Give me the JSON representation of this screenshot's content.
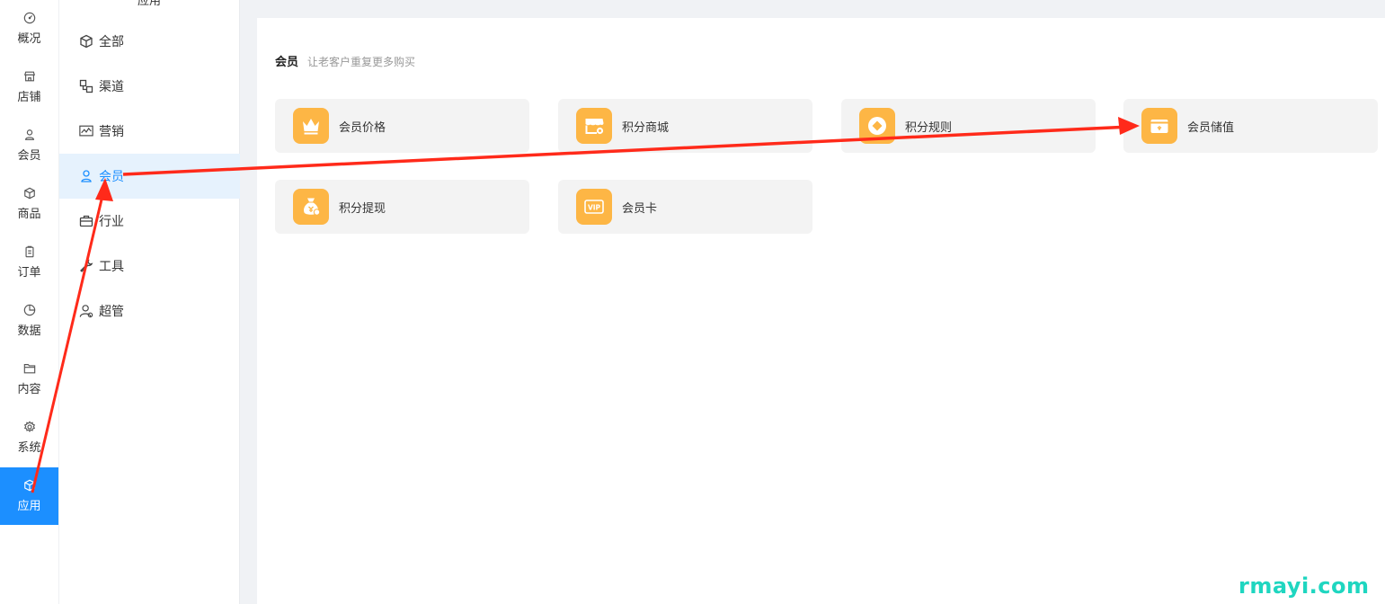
{
  "rail": {
    "items": [
      {
        "label": "概况",
        "icon": "dashboard-icon"
      },
      {
        "label": "店铺",
        "icon": "store-icon"
      },
      {
        "label": "会员",
        "icon": "user-icon"
      },
      {
        "label": "商品",
        "icon": "box-icon"
      },
      {
        "label": "订单",
        "icon": "clipboard-icon"
      },
      {
        "label": "数据",
        "icon": "pie-chart-icon"
      },
      {
        "label": "内容",
        "icon": "folder-icon"
      },
      {
        "label": "系统",
        "icon": "gear-icon"
      },
      {
        "label": "应用",
        "icon": "box-icon"
      }
    ],
    "active": "应用"
  },
  "submenu": {
    "title": "应用",
    "items": [
      {
        "label": "全部",
        "icon": "cube-icon"
      },
      {
        "label": "渠道",
        "icon": "channel-icon"
      },
      {
        "label": "营销",
        "icon": "trend-icon"
      },
      {
        "label": "会员",
        "icon": "user-icon"
      },
      {
        "label": "行业",
        "icon": "briefcase-icon"
      },
      {
        "label": "工具",
        "icon": "wrench-icon"
      },
      {
        "label": "超管",
        "icon": "admin-icon"
      }
    ],
    "active": "会员"
  },
  "main": {
    "section_title": "会员",
    "section_subtitle": "让老客户重复更多购买",
    "cards": [
      {
        "label": "会员价格",
        "icon": "crown-icon"
      },
      {
        "label": "积分商城",
        "icon": "shop-icon"
      },
      {
        "label": "积分规则",
        "icon": "coin-icon"
      },
      {
        "label": "会员储值",
        "icon": "wallet-icon"
      },
      {
        "label": "积分提现",
        "icon": "money-bag-icon"
      },
      {
        "label": "会员卡",
        "icon": "vip-card-icon"
      }
    ]
  },
  "watermark": "rmayi.com",
  "colors": {
    "accent": "#1c8fff",
    "active_bg": "#e6f2fd",
    "card_icon_bg": "#fdb645",
    "card_bg": "#f3f3f3",
    "annotation_arrow": "#ff2a1a",
    "watermark": "#1fd6c0"
  }
}
